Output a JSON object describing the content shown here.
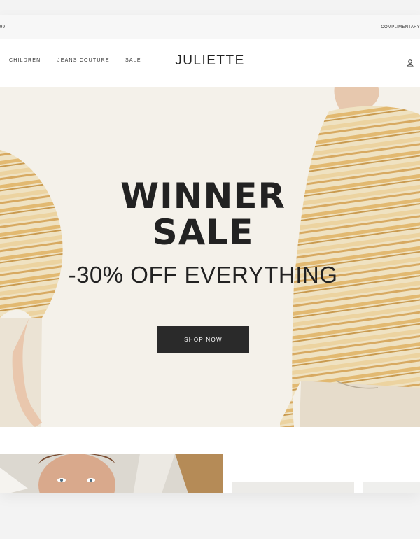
{
  "topbar": {
    "left_text": "99",
    "right_text": "COMPLIMENTARY"
  },
  "nav": {
    "items": [
      {
        "label": "CHILDREN"
      },
      {
        "label": "JEANS COUTURE"
      },
      {
        "label": "SALE"
      }
    ],
    "logo": "JULIETTE",
    "account_icon": "user-icon"
  },
  "hero": {
    "title_line1": "WINNER",
    "title_line2": "SALE",
    "subtitle": "-30% OFF EVERYTHING",
    "button_label": "SHOP NOW",
    "background_color": "#f4f1ea"
  },
  "colors": {
    "button_bg": "#2a2a2a",
    "text": "#222222",
    "sweater": "#e6c98d"
  }
}
